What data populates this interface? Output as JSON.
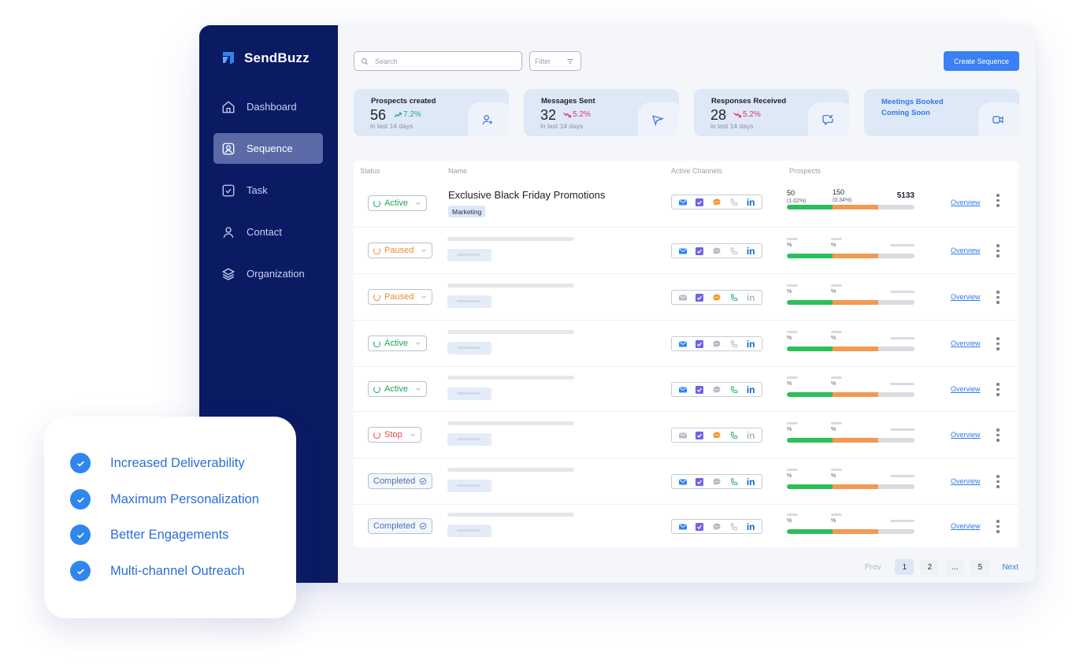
{
  "brand": {
    "name": "SendBuzz"
  },
  "nav": [
    {
      "label": "Dashboard",
      "icon": "home-icon",
      "active": false
    },
    {
      "label": "Sequence",
      "icon": "user-square-icon",
      "active": true
    },
    {
      "label": "Task",
      "icon": "checkbox-icon",
      "active": false
    },
    {
      "label": "Contact",
      "icon": "person-icon",
      "active": false
    },
    {
      "label": "Organization",
      "icon": "layers-icon",
      "active": false
    }
  ],
  "toolbar": {
    "search_placeholder": "Search",
    "filter_label": "Filter",
    "create_label": "Create Sequence"
  },
  "stats": [
    {
      "title": "Prospects created",
      "value": "56",
      "change": "7.2%",
      "trend": "up",
      "sub": "in last 14 days",
      "icon": "user-plus-icon"
    },
    {
      "title": "Messages Sent",
      "value": "32",
      "change": "5.2%",
      "trend": "down",
      "sub": "in last 14 days",
      "icon": "send-icon"
    },
    {
      "title": "Responses Received",
      "value": "28",
      "change": "5.2%",
      "trend": "down",
      "sub": "in last 14 days",
      "icon": "reply-icon"
    },
    {
      "title_line1": "Meetings Booked",
      "title_line2": "Coming Soon",
      "icon": "video-icon"
    }
  ],
  "table": {
    "headers": {
      "status": "Status",
      "name": "Name",
      "channels": "Active Channels",
      "prospects": "Prospects"
    },
    "rows": [
      {
        "status": "Active",
        "name": "Exclusive Black Friday Promotions",
        "tag": "Marketing",
        "p1": "50",
        "p1pct": "(1.02%)",
        "p2": "150",
        "p2pct": "(0.34%)",
        "total": "5133",
        "overview": "Overview"
      },
      {
        "status": "Paused",
        "pct1": "%",
        "pct2": "%",
        "overview": "Overview"
      },
      {
        "status": "Paused",
        "pct1": "%",
        "pct2": "%",
        "overview": "Overview"
      },
      {
        "status": "Active",
        "pct1": "%",
        "pct2": "%",
        "overview": "Overview"
      },
      {
        "status": "Active",
        "pct1": "%",
        "pct2": "%",
        "overview": "Overview"
      },
      {
        "status": "Stop",
        "pct1": "%",
        "pct2": "%",
        "overview": "Overview"
      },
      {
        "status": "Completed",
        "pct1": "%",
        "pct2": "%",
        "overview": "Overview"
      },
      {
        "status": "Completed",
        "pct1": "%",
        "pct2": "%",
        "overview": "Overview"
      }
    ]
  },
  "pagination": {
    "prev": "Prev",
    "pages": [
      "1",
      "2",
      "...",
      "5"
    ],
    "next": "Next",
    "current": "1"
  },
  "features": [
    "Increased Deliverability",
    "Maximum Personalization",
    "Better Engagements",
    "Multi-channel Outreach"
  ],
  "colors": {
    "sidebar": "#0a1a63",
    "accent": "#3b7ff5",
    "active": "#1fa65a",
    "paused": "#e98a2b",
    "stop": "#e5474b",
    "completed": "#4b6fb3",
    "green_bar": "#2bbf5b",
    "orange_bar": "#f29a50"
  }
}
